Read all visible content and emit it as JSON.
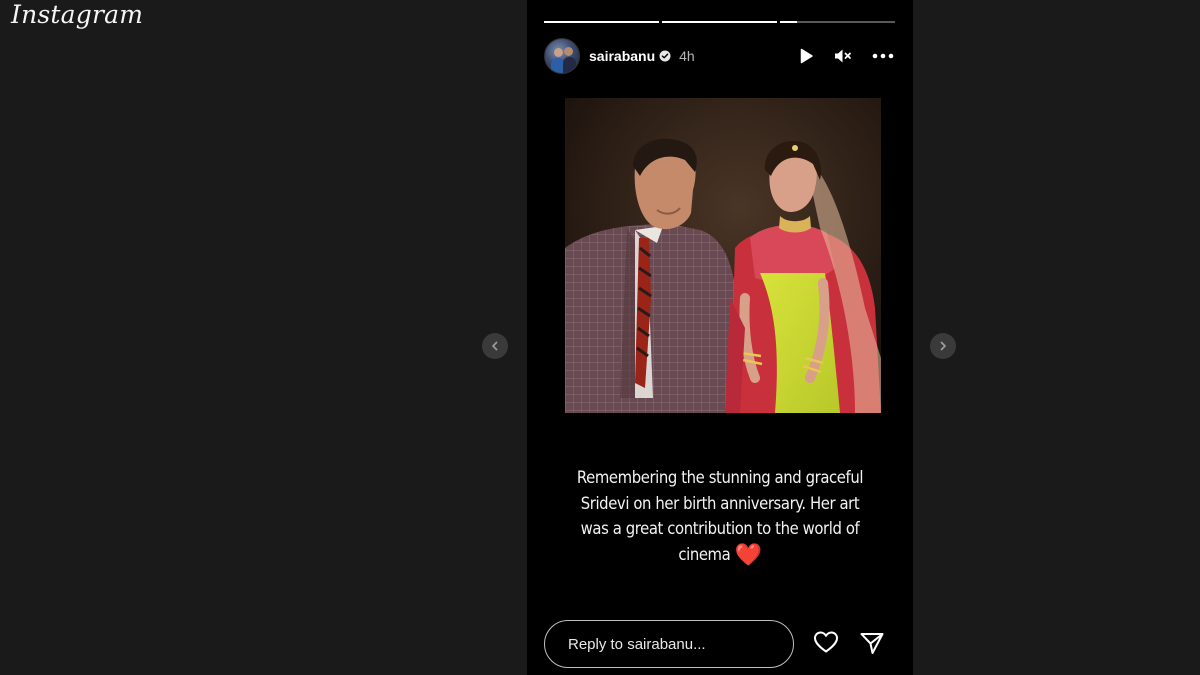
{
  "app": {
    "logo": "Instagram"
  },
  "story": {
    "progress_segments": [
      1.0,
      1.0,
      0.15
    ],
    "username": "sairabanu",
    "time": "4h",
    "caption_lines": [
      "Remembering the stunning and graceful",
      "Sridevi on her birth anniversary. Her art",
      "was a great contribution to the world of",
      "cinema"
    ],
    "heart_emoji": "❤️",
    "reply_placeholder": "Reply to sairabanu..."
  },
  "icons": {
    "verified": "verified-badge-icon",
    "play": "play-icon",
    "mute": "mute-icon",
    "more": "more-options-icon",
    "like": "heart-icon",
    "share": "send-icon",
    "prev": "chevron-left-icon",
    "next": "chevron-right-icon"
  },
  "colors": {
    "background": "#1a1a1a",
    "story_bg": "#000000",
    "heart": "#e02828"
  }
}
